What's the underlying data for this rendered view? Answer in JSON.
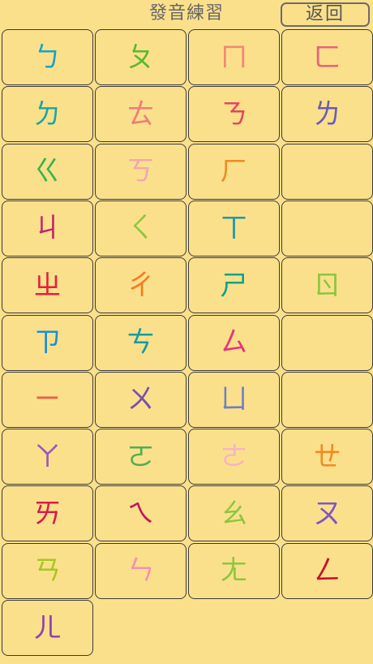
{
  "header": {
    "title": "發音練習",
    "back_label": "返回"
  },
  "symbols": [
    {
      "label": "ㄅ",
      "color": "#1aa3c2"
    },
    {
      "label": "ㄆ",
      "color": "#5cb82e"
    },
    {
      "label": "ㄇ",
      "color": "#f08a73"
    },
    {
      "label": "ㄈ",
      "color": "#ee5f7a"
    },
    {
      "label": "ㄉ",
      "color": "#1aa79d"
    },
    {
      "label": "ㄊ",
      "color": "#ee7d78"
    },
    {
      "label": "ㄋ",
      "color": "#e8445e"
    },
    {
      "label": "ㄌ",
      "color": "#6a5bb5"
    },
    {
      "label": "ㄍ",
      "color": "#38b54a"
    },
    {
      "label": "ㄎ",
      "color": "#f4a6b4"
    },
    {
      "label": "ㄏ",
      "color": "#f08a25"
    },
    {
      "label": "",
      "color": ""
    },
    {
      "label": "ㄐ",
      "color": "#c2246e"
    },
    {
      "label": "ㄑ",
      "color": "#8cc63f"
    },
    {
      "label": "ㄒ",
      "color": "#1a9aa6"
    },
    {
      "label": "",
      "color": ""
    },
    {
      "label": "ㄓ",
      "color": "#e51e3c"
    },
    {
      "label": "ㄔ",
      "color": "#f47b20"
    },
    {
      "label": "ㄕ",
      "color": "#15a089"
    },
    {
      "label": "ㄖ",
      "color": "#8cc63f"
    },
    {
      "label": "ㄗ",
      "color": "#1b8fd0"
    },
    {
      "label": "ㄘ",
      "color": "#159ba0"
    },
    {
      "label": "ㄙ",
      "color": "#e5357a"
    },
    {
      "label": "",
      "color": ""
    },
    {
      "label": "ㄧ",
      "color": "#f05a4f"
    },
    {
      "label": "ㄨ",
      "color": "#7b4fb0"
    },
    {
      "label": "ㄩ",
      "color": "#6e7fc2"
    },
    {
      "label": "",
      "color": ""
    },
    {
      "label": "ㄚ",
      "color": "#9b59b6"
    },
    {
      "label": "ㄛ",
      "color": "#4cb050"
    },
    {
      "label": "ㄜ",
      "color": "#f7b3c5"
    },
    {
      "label": "ㄝ",
      "color": "#f08a25"
    },
    {
      "label": "ㄞ",
      "color": "#d91c47"
    },
    {
      "label": "ㄟ",
      "color": "#c2185b"
    },
    {
      "label": "ㄠ",
      "color": "#8cc63f"
    },
    {
      "label": "ㄡ",
      "color": "#7e57c2"
    },
    {
      "label": "ㄢ",
      "color": "#a7c81e"
    },
    {
      "label": "ㄣ",
      "color": "#f58fb0"
    },
    {
      "label": "ㄤ",
      "color": "#8cc63f"
    },
    {
      "label": "ㄥ",
      "color": "#c8102e"
    },
    {
      "label": "ㄦ",
      "color": "#8e44ad"
    }
  ]
}
